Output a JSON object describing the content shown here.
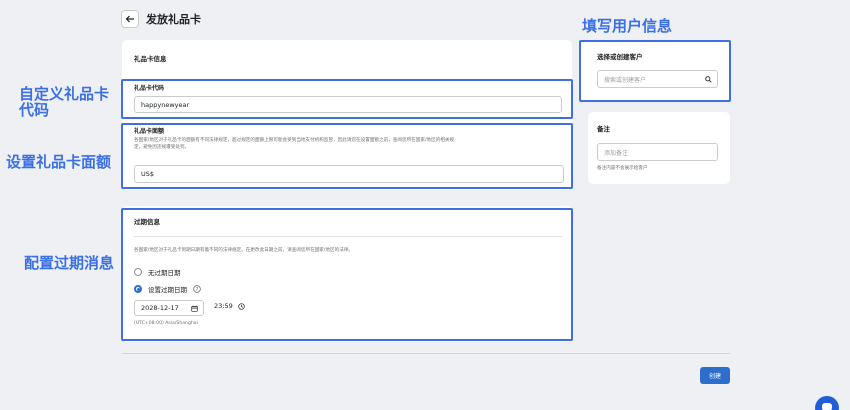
{
  "header": {
    "title": "发放礼品卡"
  },
  "annotations": {
    "user_info": "填写用户信息",
    "custom_code_line1": "自定义礼品卡",
    "custom_code_line2": "代码",
    "face_value": "设置礼品卡面额",
    "expiry": "配置过期消息"
  },
  "gift_card": {
    "section_title": "礼品卡信息",
    "code_label": "礼品卡代码",
    "code_value": "happynewyear",
    "amount_label": "礼品卡面额",
    "amount_desc_line1": "各国家/地区对于礼品卡的面额有不同法律规定，超过规定的面额上限可能会受到当地支付机构监管，因此请您在设置面额之前，查阅您所在国家/地区的相关规",
    "amount_desc_line2": "定，避免因违规遭受处罚。",
    "amount_value": "US$"
  },
  "expiry": {
    "section_title": "过期信息",
    "desc": "各国家/地区对于礼品卡到期日期有着不同的法律规定。在更改此日期之前，请查阅您所在国家/地区的法律。",
    "option_none": "无过期日期",
    "option_set": "设置过期日期",
    "date_value": "2028-12-17",
    "time_value": "23:59",
    "timezone": "(UTC+08:00) Asia/Shanghai"
  },
  "customer": {
    "title": "选择或创建客户",
    "search_placeholder": "搜索或创建客户"
  },
  "note": {
    "title": "备注",
    "placeholder": "添加备注",
    "hint": "备注内容不会展示给客户"
  },
  "actions": {
    "create": "创建"
  },
  "colors": {
    "annotation": "#3b6fe6",
    "primary": "#2c6ecb",
    "highlight_border": "#3f6ee6"
  }
}
